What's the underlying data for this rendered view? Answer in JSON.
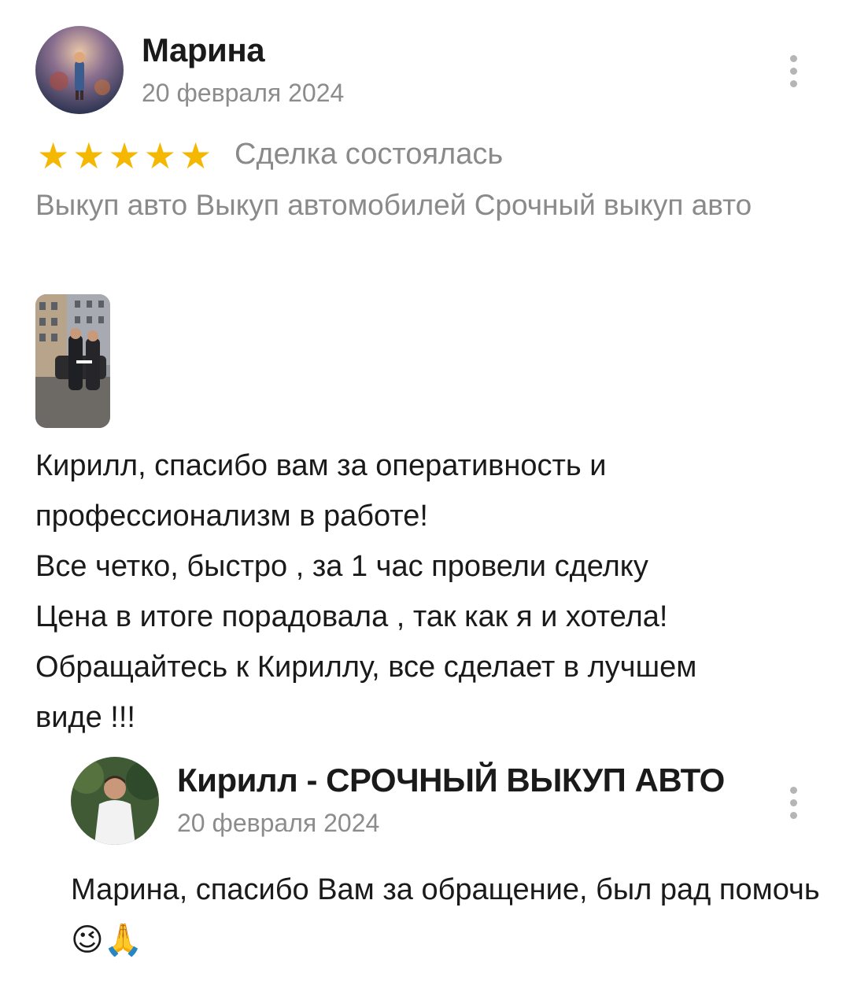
{
  "review": {
    "author": "Марина",
    "date": "20 февраля 2024",
    "rating": 5,
    "rating_max": 5,
    "status": "Сделка состоялась",
    "tags": "Выкуп авто Выкуп автомобилей Срочный выкуп авто",
    "text_lines": [
      "Кирилл, спасибо вам за оперативность и",
      "профессионализм в работе!",
      "Все четко, быстро , за 1 час провели сделку",
      "Цена в итоге порадовала , так как я и хотела!",
      "Обращайтесь к Кириллу, все сделает в лучшем",
      "виде !!!"
    ]
  },
  "reply": {
    "author": "Кирилл - СРОЧНЫЙ ВЫКУП АВТО",
    "date": "20 февраля 2024",
    "text": "Марина, спасибо Вам за обращение, был рад помочь",
    "emojis": "😉🙏"
  },
  "icons": {
    "star": "star-icon",
    "more": "more-vertical-icon"
  },
  "colors": {
    "star": "#f5b800",
    "muted_text": "#8a8a8a",
    "text": "#1a1a1a"
  }
}
